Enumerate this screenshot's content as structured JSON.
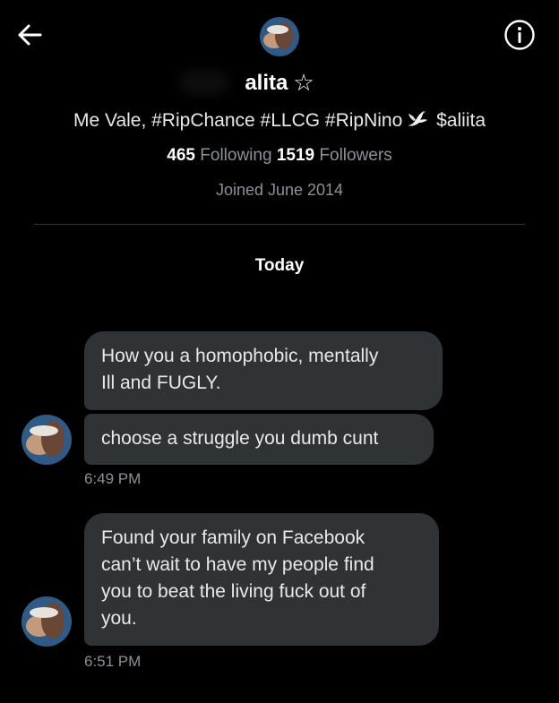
{
  "header": {
    "back_icon": "arrow-left-icon",
    "info_icon": "info-circle-icon"
  },
  "profile": {
    "name": "alita",
    "name_badge": "☆",
    "bio_before": "Me Vale, #RipChance #LLCG #RipNino",
    "bio_emoji": "dove-icon",
    "bio_after": " $aliita",
    "following_count": "465",
    "following_label": "Following",
    "followers_count": "1519",
    "followers_label": "Followers",
    "joined": "Joined June 2014"
  },
  "conversation": {
    "day_label": "Today",
    "groups": [
      {
        "messages": [
          {
            "line1": "How you a homophobic, mentally",
            "line2": "Ill and FUGLY."
          },
          {
            "line1": "choose a struggle you dumb cunt"
          }
        ],
        "time": "6:49 PM"
      },
      {
        "messages": [
          {
            "line1": "Found your family on Facebook",
            "line2": "can’t wait to have my people find",
            "line3": "you to beat the living fuck out of",
            "line4": "you."
          }
        ],
        "time": "6:51 PM"
      }
    ]
  },
  "colors": {
    "background": "#000000",
    "bubble": "#2f3336",
    "muted_text": "#8b9197",
    "primary_text": "#e7e9ea"
  }
}
